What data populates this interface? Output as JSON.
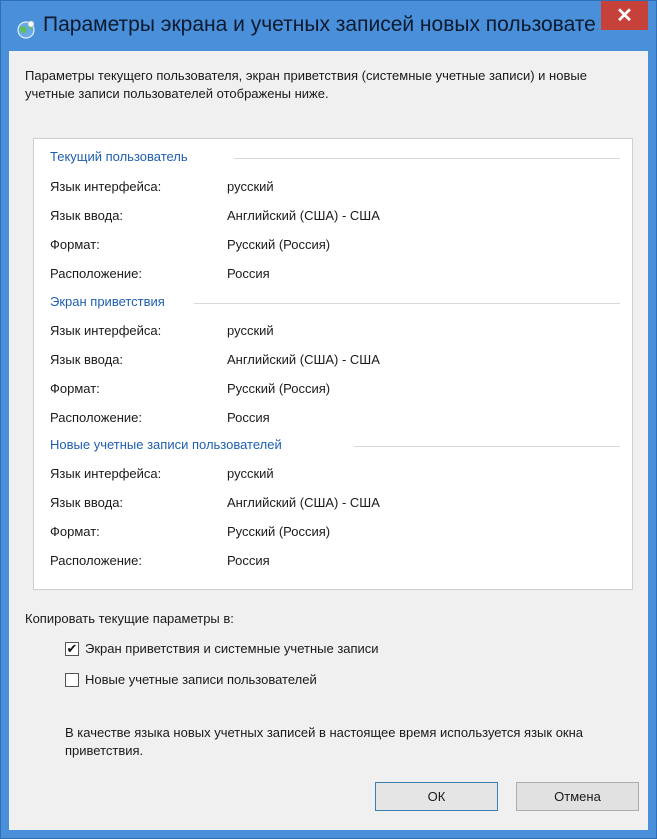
{
  "window": {
    "title": "Параметры экрана и учетных записей новых пользовате...",
    "close_glyph": "✕"
  },
  "intro": "Параметры текущего пользователя, экран приветствия (системные учетные записи) и новые учетные записи пользователей отображены ниже.",
  "sections": [
    {
      "header": "Текущий пользователь",
      "rows": [
        {
          "label": "Язык интерфейса:",
          "value": "русский"
        },
        {
          "label": "Язык ввода:",
          "value": "Английский (США) - США"
        },
        {
          "label": "Формат:",
          "value": "Русский (Россия)"
        },
        {
          "label": "Расположение:",
          "value": "Россия"
        }
      ]
    },
    {
      "header": "Экран приветствия",
      "rows": [
        {
          "label": "Язык интерфейса:",
          "value": "русский"
        },
        {
          "label": "Язык ввода:",
          "value": "Английский (США) - США"
        },
        {
          "label": "Формат:",
          "value": "Русский (Россия)"
        },
        {
          "label": "Расположение:",
          "value": "Россия"
        }
      ]
    },
    {
      "header": "Новые учетные записи пользователей",
      "rows": [
        {
          "label": "Язык интерфейса:",
          "value": "русский"
        },
        {
          "label": "Язык ввода:",
          "value": "Английский (США) - США"
        },
        {
          "label": "Формат:",
          "value": "Русский (Россия)"
        },
        {
          "label": "Расположение:",
          "value": "Россия"
        }
      ]
    }
  ],
  "copy": {
    "label": "Копировать текущие параметры в:",
    "options": [
      {
        "label": "Экран приветствия и системные учетные записи",
        "checked": true
      },
      {
        "label": "Новые учетные записи пользователей",
        "checked": false
      }
    ],
    "note": "В качестве языка новых учетных записей в настоящее время используется язык окна приветствия."
  },
  "buttons": {
    "ok": "ОК",
    "cancel": "Отмена"
  },
  "colors": {
    "titlebar": "#4a8fd9",
    "close": "#c7413b",
    "section_header": "#1f5fb0"
  },
  "icons": {
    "title": "globe-icon",
    "check": "checkmark-icon"
  }
}
